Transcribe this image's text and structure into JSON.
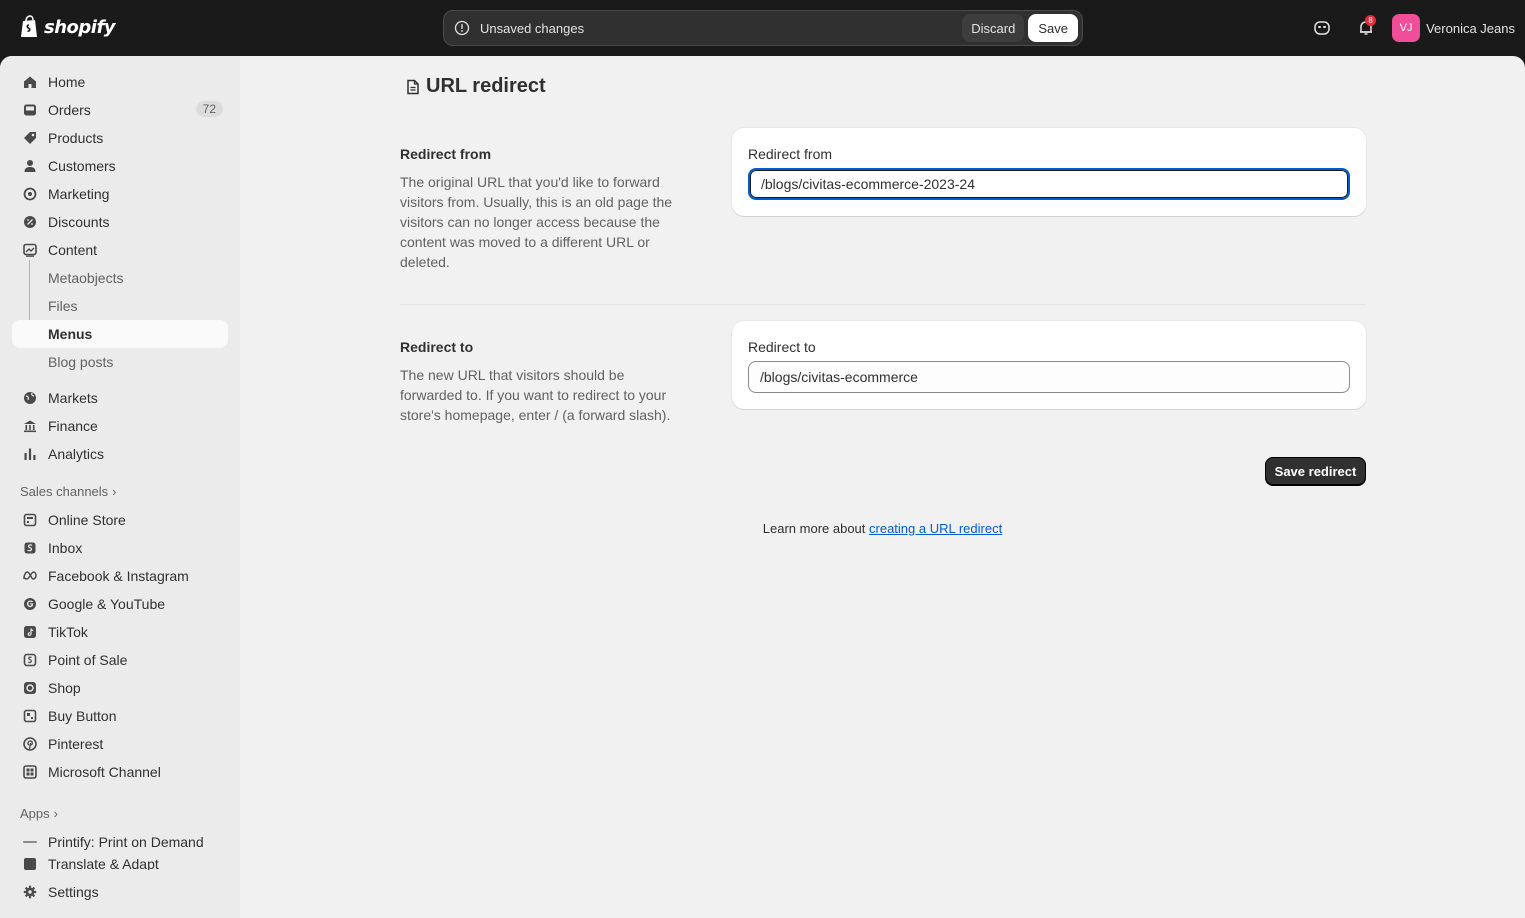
{
  "brand": {
    "name": "shopify"
  },
  "savebar": {
    "message": "Unsaved changes",
    "discard": "Discard",
    "save": "Save"
  },
  "user": {
    "initials": "VJ",
    "name": "Veronica Jeans",
    "notification_count": "8"
  },
  "sidebar": {
    "items": [
      {
        "label": "Home",
        "icon": "home-icon"
      },
      {
        "label": "Orders",
        "icon": "orders-icon",
        "count": "72"
      },
      {
        "label": "Products",
        "icon": "tag-icon"
      },
      {
        "label": "Customers",
        "icon": "person-icon"
      },
      {
        "label": "Marketing",
        "icon": "target-icon"
      },
      {
        "label": "Discounts",
        "icon": "discount-icon"
      },
      {
        "label": "Content",
        "icon": "image-icon"
      },
      {
        "label": "Metaobjects"
      },
      {
        "label": "Files"
      },
      {
        "label": "Menus"
      },
      {
        "label": "Blog posts"
      },
      {
        "label": "Markets",
        "icon": "globe-icon"
      },
      {
        "label": "Finance",
        "icon": "bank-icon"
      },
      {
        "label": "Analytics",
        "icon": "bar-chart-icon"
      }
    ],
    "sales_channels_header": "Sales channels",
    "channels": [
      {
        "label": "Online Store"
      },
      {
        "label": "Inbox"
      },
      {
        "label": "Facebook & Instagram"
      },
      {
        "label": "Google & YouTube"
      },
      {
        "label": "TikTok"
      },
      {
        "label": "Point of Sale"
      },
      {
        "label": "Shop"
      },
      {
        "label": "Buy Button"
      },
      {
        "label": "Pinterest"
      },
      {
        "label": "Microsoft Channel"
      }
    ],
    "apps_header": "Apps",
    "apps": [
      {
        "label": "Printify: Print on Demand"
      },
      {
        "label": "Translate & Adapt"
      }
    ],
    "settings": "Settings"
  },
  "page": {
    "title": "URL redirect",
    "from": {
      "title": "Redirect from",
      "description": "The original URL that you'd like to forward visitors from. Usually, this is an old page the visitors can no longer access because the content was moved to a different URL or deleted.",
      "label": "Redirect from",
      "value": "/blogs/civitas-ecommerce-2023-24"
    },
    "to": {
      "title": "Redirect to",
      "description": "The new URL that visitors should be forwarded to. If you want to redirect to your store's homepage, enter / (a forward slash).",
      "label": "Redirect to",
      "value": "/blogs/civitas-ecommerce"
    },
    "save_button": "Save redirect",
    "learn_prefix": "Learn more about ",
    "learn_link": "creating a URL redirect"
  },
  "colors": {
    "accent": "#005bd3",
    "topbar": "#1a1a1a",
    "avatar": "#f04e98",
    "badge": "#e22c38"
  }
}
